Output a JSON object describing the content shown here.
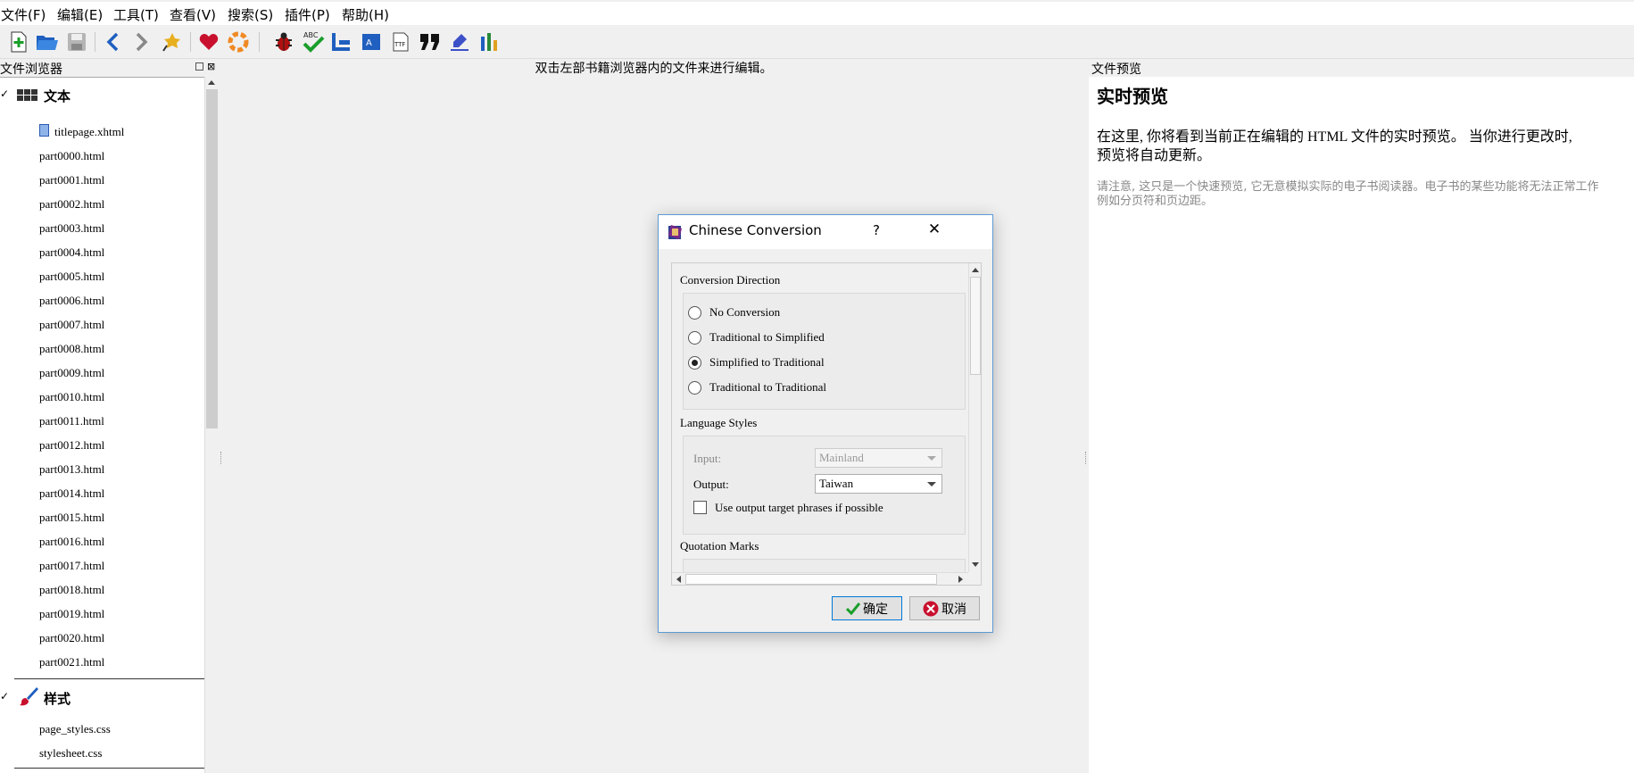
{
  "menu": [
    "文件(F)",
    "编辑(E)",
    "工具(T)",
    "查看(V)",
    "搜索(S)",
    "插件(P)",
    "帮助(H)"
  ],
  "toolbar_icons": [
    "new-file-icon",
    "open-book-icon",
    "save-icon",
    "back-icon",
    "forward-icon",
    "checkpoint-icon",
    "heart-icon",
    "lifebuoy-icon",
    "bug-icon",
    "spellcheck-icon",
    "reports-icon",
    "toc-icon",
    "font-icon",
    "quote-icon",
    "edit-clear-icon",
    "stats-icon"
  ],
  "left_panel": {
    "title": "文件浏览器",
    "text_section": "文本",
    "text_files": [
      "titlepage.xhtml",
      "part0000.html",
      "part0001.html",
      "part0002.html",
      "part0003.html",
      "part0004.html",
      "part0005.html",
      "part0006.html",
      "part0007.html",
      "part0008.html",
      "part0009.html",
      "part0010.html",
      "part0011.html",
      "part0012.html",
      "part0013.html",
      "part0014.html",
      "part0015.html",
      "part0016.html",
      "part0017.html",
      "part0018.html",
      "part0019.html",
      "part0020.html",
      "part0021.html"
    ],
    "style_section": "样式",
    "style_files": [
      "page_styles.css",
      "stylesheet.css"
    ]
  },
  "editor": {
    "hint": "双击左部书籍浏览器内的文件来进行编辑。"
  },
  "preview": {
    "title": "文件预览",
    "heading": "实时预览",
    "para1_line1": "在这里, 你将看到当前正在编辑的 HTML 文件的实时预览。 当你进行更改时,",
    "para1_line2": "预览将自动更新。",
    "note_line1": "请注意, 这只是一个快速预览, 它无意模拟实际的电子书阅读器。电子书的某些功能将无法正常工作",
    "note_line2": "例如分页符和页边距。"
  },
  "dialog": {
    "title": "Chinese Conversion",
    "help": "?",
    "close": "✕",
    "direction_label": "Conversion Direction",
    "options": [
      "No Conversion",
      "Traditional to Simplified",
      "Simplified to Traditional",
      "Traditional to Traditional"
    ],
    "selected_option": "Simplified to Traditional",
    "styles_label": "Language Styles",
    "input_label": "Input:",
    "input_value": "Mainland",
    "output_label": "Output:",
    "output_value": "Taiwan",
    "phrases_label": "Use output target phrases if possible",
    "phrases_checked": false,
    "quotation_label": "Quotation Marks",
    "ok": "确定",
    "cancel": "取消"
  }
}
